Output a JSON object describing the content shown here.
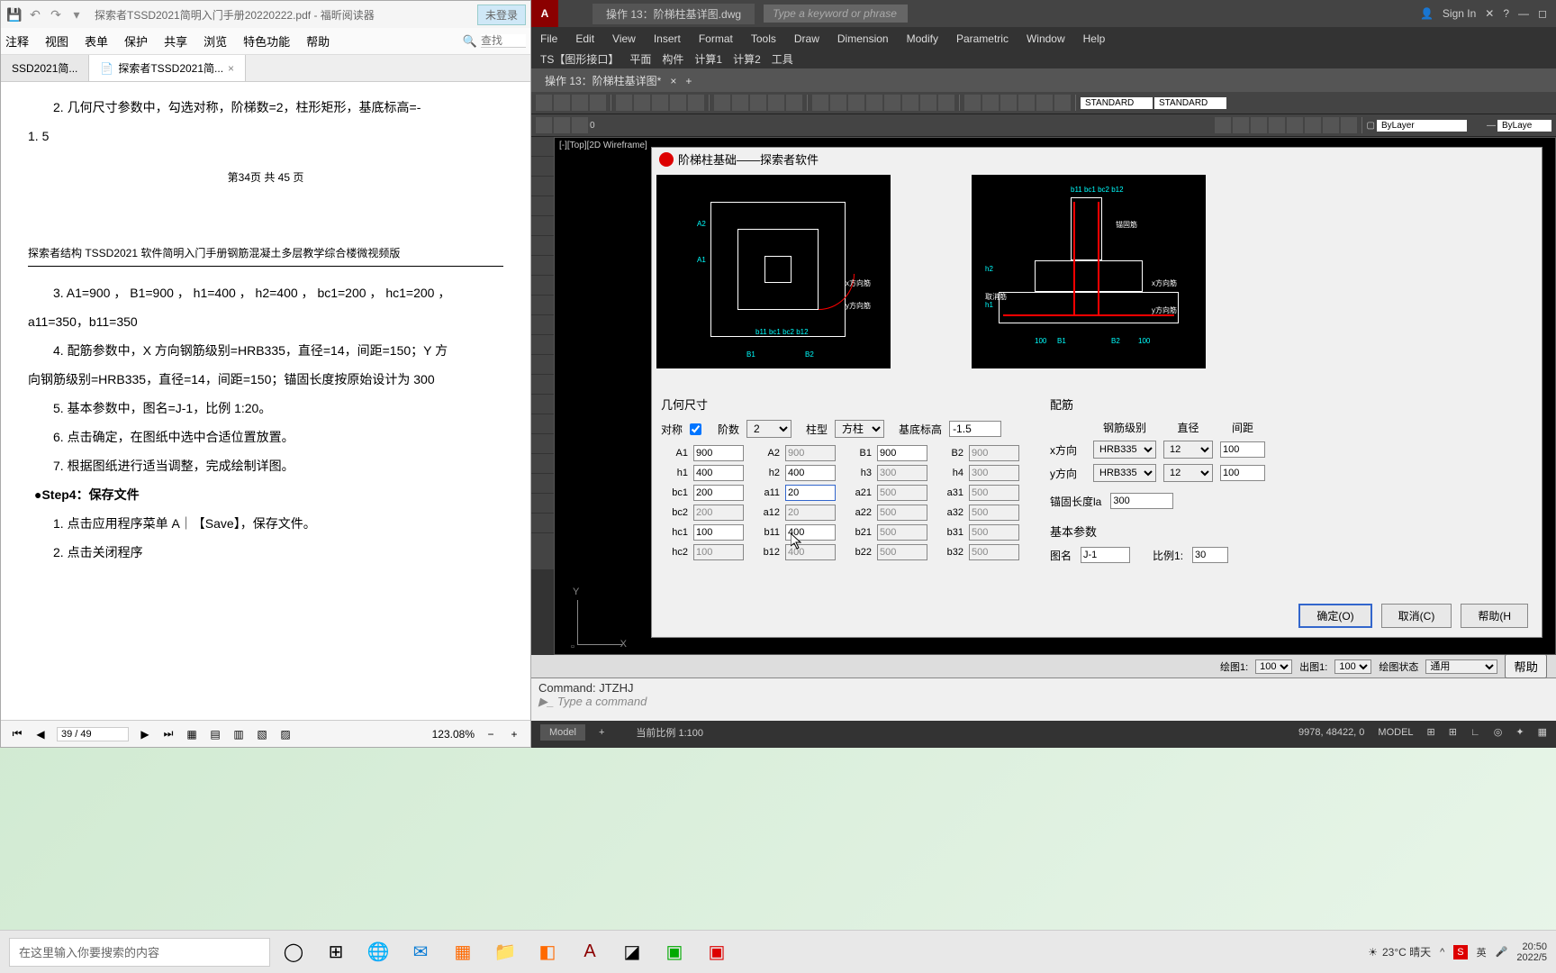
{
  "pdf": {
    "title": "探索者TSSD2021简明入门手册20220222.pdf - 福昕阅读器",
    "login": "未登录",
    "menu": [
      "注释",
      "视图",
      "表单",
      "保护",
      "共享",
      "浏览",
      "特色功能",
      "帮助"
    ],
    "search_ph": "查找",
    "tabs": [
      "SSD2021简...",
      "探索者TSSD2021简..."
    ],
    "body": {
      "l1": "2. 几何尺寸参数中，勾选对称，阶梯数=2，柱形矩形，基底标高=-",
      "l2": "1. 5",
      "pg": "第34页 共 45 页",
      "doc_title": "探索者结构 TSSD2021 软件简明入门手册钢筋混凝土多层教学综合楼微视频版",
      "l3": "3. A1=900 ， B1=900 ， h1=400 ， h2=400 ， bc1=200 ， hc1=200 ，",
      "l4": "a11=350，b11=350",
      "l5": "4. 配筋参数中，X 方向钢筋级别=HRB335，直径=14，间距=150；Y 方",
      "l6": "向钢筋级别=HRB335，直径=14，间距=150；锚固长度按原始设计为 300",
      "l7": "5. 基本参数中，图名=J-1，比例 1:20。",
      "l8": "6. 点击确定，在图纸中选中合适位置放置。",
      "l9": "7. 根据图纸进行适当调整，完成绘制详图。",
      "step": "●Step4：保存文件",
      "l10": "1. 点击应用程序菜单 A｜【Save】，保存文件。",
      "l11": "2. 点击关闭程序"
    },
    "status": {
      "page": "39 / 49",
      "zoom": "123.08%"
    }
  },
  "cad": {
    "doc": "操作 13：阶梯柱基详图.dwg",
    "search_ph": "Type a keyword or phrase",
    "signin": "Sign In",
    "menu": [
      "File",
      "Edit",
      "View",
      "Insert",
      "Format",
      "Tools",
      "Draw",
      "Dimension",
      "Modify",
      "Parametric",
      "Window",
      "Help"
    ],
    "menu2": [
      "TS【图形接口】",
      "平面",
      "构件",
      "计算1",
      "计算2",
      "工具"
    ],
    "doctab": "操作 13：阶梯柱基详图*",
    "layer1": "STANDARD",
    "layer2": "STANDARD",
    "bylayer": "ByLayer",
    "vplabel": "[-][Top][2D Wireframe]",
    "cmd1": "Command: JTZHJ",
    "cmd2": "Type a command",
    "footer1": {
      "l1": "绘图1:",
      "v1": "100",
      "l2": "出图1:",
      "v2": "100",
      "l3": "绘图状态",
      "v3": "通用",
      "help": "帮助"
    },
    "footer2": {
      "model": "Model",
      "scale": "当前比例 1:100",
      "coord": "9978, 48422, 0",
      "ms": "MODEL"
    }
  },
  "dialog": {
    "title": "阶梯柱基础——探索者软件",
    "geom_title": "几何尺寸",
    "sym": "对称",
    "steps_l": "阶数",
    "steps_v": "2",
    "coltype_l": "柱型",
    "coltype_v": "方柱",
    "base_l": "基底标高",
    "base_v": "-1.5",
    "params": {
      "A1": "900",
      "A2": "900",
      "B1": "900",
      "B2": "900",
      "h1": "400",
      "h2": "400",
      "h3": "300",
      "h4": "300",
      "bc1": "200",
      "a11": "20",
      "a21": "500",
      "a31": "500",
      "bc2": "200",
      "a12": "20",
      "a22": "500",
      "a32": "500",
      "hc1": "100",
      "b11": "400",
      "b21": "500",
      "b31": "500",
      "hc2": "100",
      "b12": "400",
      "b22": "500",
      "b32": "500"
    },
    "rebar_title": "配筋",
    "rebar_hdrs": [
      "钢筋级别",
      "直径",
      "间距"
    ],
    "xdir": "x方向",
    "ydir": "y方向",
    "grade": "HRB335",
    "dia": "12",
    "spc": "100",
    "anchor_l": "锚固长度la",
    "anchor_v": "300",
    "basic_title": "基本参数",
    "name_l": "图名",
    "name_v": "J-1",
    "scale_l": "比例1:",
    "scale_v": "30",
    "ok": "确定(O)",
    "cancel": "取消(C)",
    "help": "帮助(H"
  },
  "taskbar": {
    "search": "在这里输入你要搜索的内容",
    "weather": "23°C 晴天",
    "ime": "英",
    "time": "20:50",
    "date": "2022/5"
  },
  "chart_data": {
    "type": "table",
    "title": "几何尺寸参数",
    "rows": [
      [
        "A1",
        "900",
        "A2",
        "900",
        "B1",
        "900",
        "B2",
        "900"
      ],
      [
        "h1",
        "400",
        "h2",
        "400",
        "h3",
        "300",
        "h4",
        "300"
      ],
      [
        "bc1",
        "200",
        "a11",
        "20",
        "a21",
        "500",
        "a31",
        "500"
      ],
      [
        "bc2",
        "200",
        "a12",
        "20",
        "a22",
        "500",
        "a32",
        "500"
      ],
      [
        "hc1",
        "100",
        "b11",
        "400",
        "b21",
        "500",
        "b31",
        "500"
      ],
      [
        "hc2",
        "100",
        "b12",
        "400",
        "b22",
        "500",
        "b32",
        "500"
      ]
    ]
  }
}
